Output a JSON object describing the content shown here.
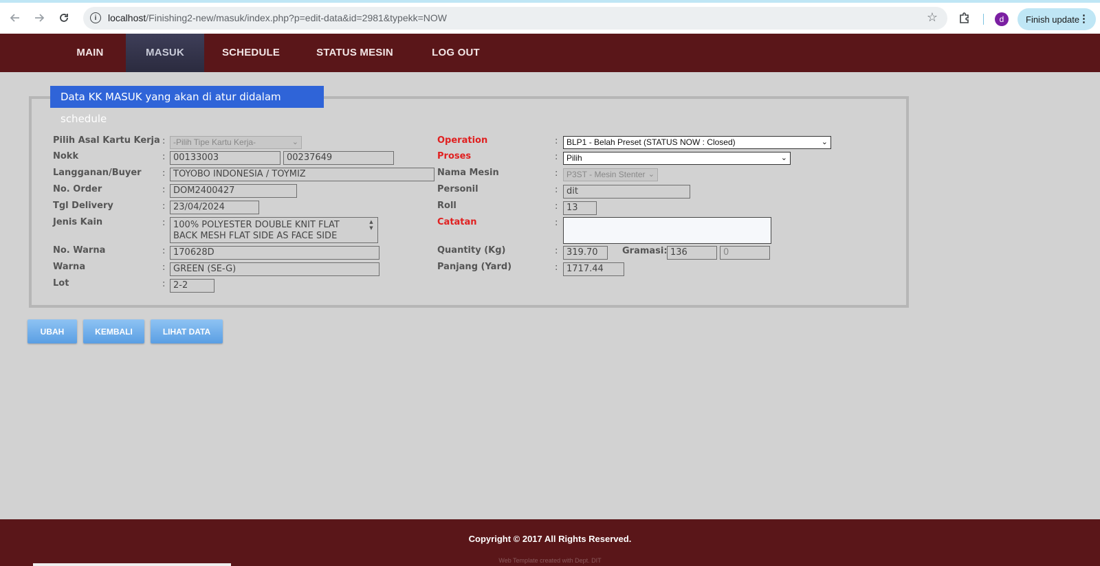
{
  "browser": {
    "url_host": "localhost",
    "url_path": "/Finishing2-new/masuk/index.php?p=edit-data&id=2981&typekk=NOW",
    "profile_initial": "d",
    "finish_update_label": "Finish update"
  },
  "nav": {
    "items": [
      {
        "label": "MAIN"
      },
      {
        "label": "MASUK"
      },
      {
        "label": "SCHEDULE"
      },
      {
        "label": "STATUS MESIN"
      },
      {
        "label": "LOG OUT"
      }
    ],
    "active": "MASUK"
  },
  "panel": {
    "title": "Data KK MASUK yang akan di atur didalam schedule"
  },
  "left": {
    "asal_label": "Pilih Asal Kartu Kerja",
    "asal_value": "-Pilih Tipe Kartu Kerja-",
    "nokk_label": "Nokk",
    "nokk_value1": "00133003",
    "nokk_value2": "00237649",
    "buyer_label": "Langganan/Buyer",
    "buyer_value": "TOYOBO INDONESIA / TOYMIZ",
    "order_label": "No. Order",
    "order_value": "DOM2400427",
    "delivery_label": "Tgl Delivery",
    "delivery_value": "23/04/2024",
    "kain_label": "Jenis Kain",
    "kain_value": "100% POLYESTER DOUBLE KNIT FLAT BACK MESH FLAT SIDE AS FACE SIDE",
    "nowarna_label": "No. Warna",
    "nowarna_value": "170628D",
    "warna_label": "Warna",
    "warna_value": "GREEN (SE-G)",
    "lot_label": "Lot",
    "lot_value": "2-2"
  },
  "right": {
    "operation_label": "Operation",
    "operation_value": "BLP1 - Belah Preset (STATUS NOW : Closed)",
    "proses_label": "Proses",
    "proses_value": "Pilih",
    "mesin_label": "Nama Mesin",
    "mesin_value": "P3ST - Mesin Stenter",
    "personil_label": "Personil",
    "personil_value": "dit",
    "roll_label": "Roll",
    "roll_value": "13",
    "catatan_label": "Catatan",
    "catatan_value": "",
    "qty_label": "Quantity (Kg)",
    "qty_value": "319.70",
    "gramasi_label": "Gramasi:",
    "gramasi_value1": "136",
    "gramasi_value2": "0",
    "panjang_label": "Panjang (Yard)",
    "panjang_value": "1717.44"
  },
  "buttons": {
    "ubah": "UBAH",
    "kembali": "KEMBALI",
    "lihat": "LIHAT DATA"
  },
  "footer": {
    "copyright": "Copyright © 2017 All Rights Reserved.",
    "credit": "Web Template created with Dept. DIT"
  },
  "colors": {
    "brand_maroon": "#5a1619",
    "panel_title_blue": "#2f64d8",
    "required_red": "#e02020",
    "button_blue": "#5a9ee3"
  }
}
